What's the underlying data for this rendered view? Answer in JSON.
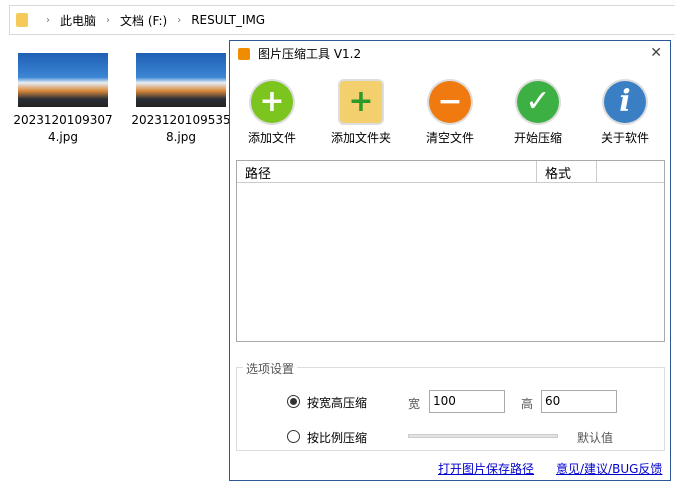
{
  "explorer": {
    "breadcrumb": [
      "此电脑",
      "文档 (F:)",
      "RESULT_IMG"
    ],
    "files": [
      {
        "name1": "2023120109307",
        "name2": "4.jpg"
      },
      {
        "name1": "2023120109535",
        "name2": "8.jpg"
      }
    ]
  },
  "dialog": {
    "title": "图片压缩工具 V1.2",
    "toolbar": [
      "添加文件",
      "添加文件夹",
      "清空文件",
      "开始压缩",
      "关于软件"
    ],
    "columns": [
      "路径",
      "格式"
    ],
    "options": {
      "group": "选项设置",
      "by_size": "按宽高压缩",
      "width_label": "宽",
      "width": "100",
      "height_label": "高",
      "height": "60",
      "by_ratio": "按比例压缩",
      "default": "默认值"
    },
    "links": {
      "open": "打开图片保存路径",
      "feedback": "意见/建议/BUG反馈"
    }
  }
}
